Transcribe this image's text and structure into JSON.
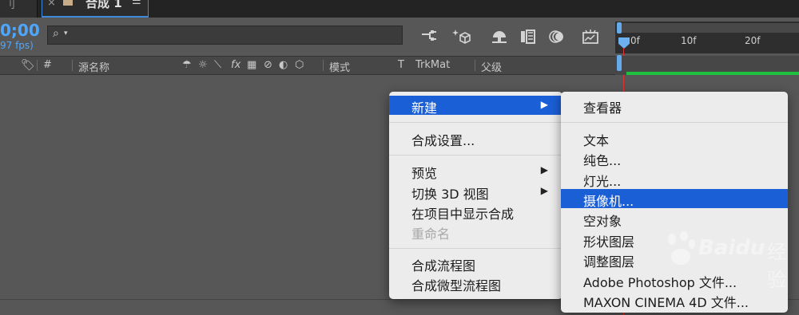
{
  "tabs": {
    "left_fragment": "刂",
    "close_glyph": "×",
    "active_title": "合成 1",
    "menu_glyph": "☰"
  },
  "timeline": {
    "timecode": "0;00",
    "fps": "97 fps)",
    "ticks": [
      "0f",
      "10f",
      "20f"
    ]
  },
  "search": {
    "icon": "⌕",
    "value": ""
  },
  "toolbar_icons": [
    "comp-flowchart-icon",
    "draft-3d-icon",
    "shy-icon",
    "frame-blend-icon",
    "motion-blur-icon",
    "graph-editor-icon"
  ],
  "columns": {
    "source_name": "源名称",
    "hash": "#",
    "mode": "模式",
    "t": "T",
    "trkmat": "TrkMat",
    "parent": "父级",
    "fx": "fx"
  },
  "context_menu": {
    "new": "新建",
    "comp_settings": "合成设置...",
    "preview": "预览",
    "switch_3d": "切换 3D 视图",
    "reveal_in_project": "在项目中显示合成",
    "rename": "重命名",
    "flowchart": "合成流程图",
    "mini_flowchart": "合成微型流程图"
  },
  "submenu": {
    "viewer": "查看器",
    "text": "文本",
    "solid": "纯色...",
    "light": "灯光...",
    "camera": "摄像机...",
    "null": "空对象",
    "shape": "形状图层",
    "adjustment": "调整图层",
    "photoshop": "Adobe Photoshop 文件...",
    "cinema4d": "MAXON CINEMA 4D 文件..."
  },
  "watermark": {
    "brand": "Baidu",
    "suffix": "经验"
  },
  "colors": {
    "accent_blue": "#4ea7ff",
    "highlight": "#1b5fd7",
    "cti_red": "#e03434",
    "work_green": "#1ec23c"
  }
}
